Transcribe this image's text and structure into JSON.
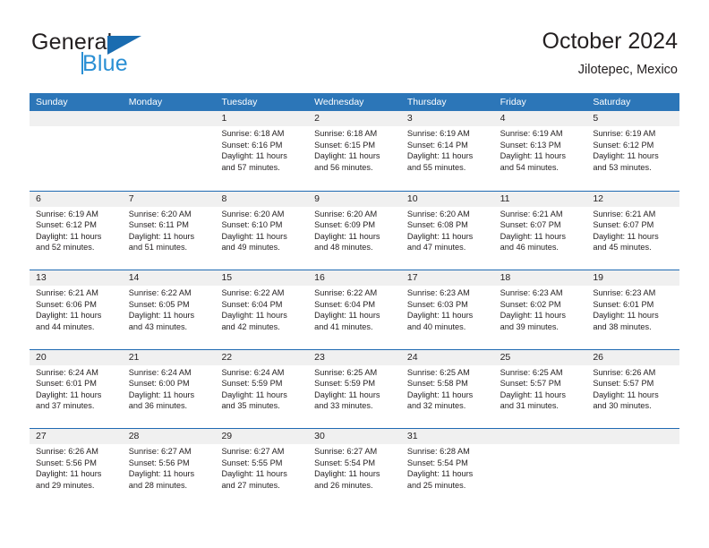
{
  "brand": {
    "word_one": "General",
    "word_two": "Blue",
    "triangle_color": "#1a6cb0",
    "blue_text_color": "#2a8fd4"
  },
  "header": {
    "title": "October 2024",
    "location": "Jilotepec, Mexico"
  },
  "theme": {
    "header_blue": "#2c76b8",
    "rule_blue": "#1f6ab2",
    "band_gray": "#f0f0f0",
    "text": "#231f20"
  },
  "weekday_headers": [
    "Sunday",
    "Monday",
    "Tuesday",
    "Wednesday",
    "Thursday",
    "Friday",
    "Saturday"
  ],
  "weeks": [
    [
      {
        "day": "",
        "lines": []
      },
      {
        "day": "",
        "lines": []
      },
      {
        "day": "1",
        "lines": [
          "Sunrise: 6:18 AM",
          "Sunset: 6:16 PM",
          "Daylight: 11 hours",
          "and 57 minutes."
        ]
      },
      {
        "day": "2",
        "lines": [
          "Sunrise: 6:18 AM",
          "Sunset: 6:15 PM",
          "Daylight: 11 hours",
          "and 56 minutes."
        ]
      },
      {
        "day": "3",
        "lines": [
          "Sunrise: 6:19 AM",
          "Sunset: 6:14 PM",
          "Daylight: 11 hours",
          "and 55 minutes."
        ]
      },
      {
        "day": "4",
        "lines": [
          "Sunrise: 6:19 AM",
          "Sunset: 6:13 PM",
          "Daylight: 11 hours",
          "and 54 minutes."
        ]
      },
      {
        "day": "5",
        "lines": [
          "Sunrise: 6:19 AM",
          "Sunset: 6:12 PM",
          "Daylight: 11 hours",
          "and 53 minutes."
        ]
      }
    ],
    [
      {
        "day": "6",
        "lines": [
          "Sunrise: 6:19 AM",
          "Sunset: 6:12 PM",
          "Daylight: 11 hours",
          "and 52 minutes."
        ]
      },
      {
        "day": "7",
        "lines": [
          "Sunrise: 6:20 AM",
          "Sunset: 6:11 PM",
          "Daylight: 11 hours",
          "and 51 minutes."
        ]
      },
      {
        "day": "8",
        "lines": [
          "Sunrise: 6:20 AM",
          "Sunset: 6:10 PM",
          "Daylight: 11 hours",
          "and 49 minutes."
        ]
      },
      {
        "day": "9",
        "lines": [
          "Sunrise: 6:20 AM",
          "Sunset: 6:09 PM",
          "Daylight: 11 hours",
          "and 48 minutes."
        ]
      },
      {
        "day": "10",
        "lines": [
          "Sunrise: 6:20 AM",
          "Sunset: 6:08 PM",
          "Daylight: 11 hours",
          "and 47 minutes."
        ]
      },
      {
        "day": "11",
        "lines": [
          "Sunrise: 6:21 AM",
          "Sunset: 6:07 PM",
          "Daylight: 11 hours",
          "and 46 minutes."
        ]
      },
      {
        "day": "12",
        "lines": [
          "Sunrise: 6:21 AM",
          "Sunset: 6:07 PM",
          "Daylight: 11 hours",
          "and 45 minutes."
        ]
      }
    ],
    [
      {
        "day": "13",
        "lines": [
          "Sunrise: 6:21 AM",
          "Sunset: 6:06 PM",
          "Daylight: 11 hours",
          "and 44 minutes."
        ]
      },
      {
        "day": "14",
        "lines": [
          "Sunrise: 6:22 AM",
          "Sunset: 6:05 PM",
          "Daylight: 11 hours",
          "and 43 minutes."
        ]
      },
      {
        "day": "15",
        "lines": [
          "Sunrise: 6:22 AM",
          "Sunset: 6:04 PM",
          "Daylight: 11 hours",
          "and 42 minutes."
        ]
      },
      {
        "day": "16",
        "lines": [
          "Sunrise: 6:22 AM",
          "Sunset: 6:04 PM",
          "Daylight: 11 hours",
          "and 41 minutes."
        ]
      },
      {
        "day": "17",
        "lines": [
          "Sunrise: 6:23 AM",
          "Sunset: 6:03 PM",
          "Daylight: 11 hours",
          "and 40 minutes."
        ]
      },
      {
        "day": "18",
        "lines": [
          "Sunrise: 6:23 AM",
          "Sunset: 6:02 PM",
          "Daylight: 11 hours",
          "and 39 minutes."
        ]
      },
      {
        "day": "19",
        "lines": [
          "Sunrise: 6:23 AM",
          "Sunset: 6:01 PM",
          "Daylight: 11 hours",
          "and 38 minutes."
        ]
      }
    ],
    [
      {
        "day": "20",
        "lines": [
          "Sunrise: 6:24 AM",
          "Sunset: 6:01 PM",
          "Daylight: 11 hours",
          "and 37 minutes."
        ]
      },
      {
        "day": "21",
        "lines": [
          "Sunrise: 6:24 AM",
          "Sunset: 6:00 PM",
          "Daylight: 11 hours",
          "and 36 minutes."
        ]
      },
      {
        "day": "22",
        "lines": [
          "Sunrise: 6:24 AM",
          "Sunset: 5:59 PM",
          "Daylight: 11 hours",
          "and 35 minutes."
        ]
      },
      {
        "day": "23",
        "lines": [
          "Sunrise: 6:25 AM",
          "Sunset: 5:59 PM",
          "Daylight: 11 hours",
          "and 33 minutes."
        ]
      },
      {
        "day": "24",
        "lines": [
          "Sunrise: 6:25 AM",
          "Sunset: 5:58 PM",
          "Daylight: 11 hours",
          "and 32 minutes."
        ]
      },
      {
        "day": "25",
        "lines": [
          "Sunrise: 6:25 AM",
          "Sunset: 5:57 PM",
          "Daylight: 11 hours",
          "and 31 minutes."
        ]
      },
      {
        "day": "26",
        "lines": [
          "Sunrise: 6:26 AM",
          "Sunset: 5:57 PM",
          "Daylight: 11 hours",
          "and 30 minutes."
        ]
      }
    ],
    [
      {
        "day": "27",
        "lines": [
          "Sunrise: 6:26 AM",
          "Sunset: 5:56 PM",
          "Daylight: 11 hours",
          "and 29 minutes."
        ]
      },
      {
        "day": "28",
        "lines": [
          "Sunrise: 6:27 AM",
          "Sunset: 5:56 PM",
          "Daylight: 11 hours",
          "and 28 minutes."
        ]
      },
      {
        "day": "29",
        "lines": [
          "Sunrise: 6:27 AM",
          "Sunset: 5:55 PM",
          "Daylight: 11 hours",
          "and 27 minutes."
        ]
      },
      {
        "day": "30",
        "lines": [
          "Sunrise: 6:27 AM",
          "Sunset: 5:54 PM",
          "Daylight: 11 hours",
          "and 26 minutes."
        ]
      },
      {
        "day": "31",
        "lines": [
          "Sunrise: 6:28 AM",
          "Sunset: 5:54 PM",
          "Daylight: 11 hours",
          "and 25 minutes."
        ]
      },
      {
        "day": "",
        "lines": []
      },
      {
        "day": "",
        "lines": []
      }
    ]
  ]
}
